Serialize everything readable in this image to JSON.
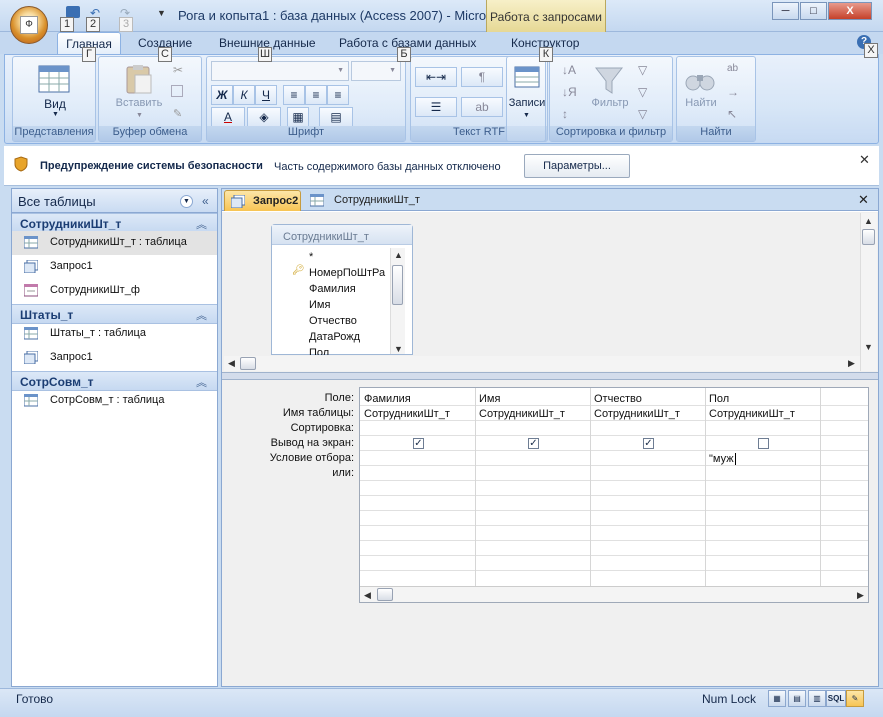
{
  "app": {
    "title": "Рога и копыта1 : база данных (Access 2007) - Micros...",
    "context_tab_title": "Работа с запросами",
    "office_button_keytip": "Ф",
    "qat_keytips": [
      "1",
      "2",
      "3"
    ]
  },
  "window_controls": {
    "minimize": "─",
    "maximize": "□",
    "close": "X",
    "help": "?"
  },
  "ribbon": {
    "tabs": [
      {
        "label": "Главная",
        "keytip": "Г"
      },
      {
        "label": "Создание",
        "keytip": "С"
      },
      {
        "label": "Внешние данные",
        "keytip": "Ш"
      },
      {
        "label": "Работа с базами данных",
        "keytip": "Б"
      },
      {
        "label": "Конструктор",
        "keytip": "К"
      }
    ],
    "groups": {
      "views": {
        "label": "Представления",
        "button": "Вид"
      },
      "clipboard": {
        "label": "Буфер обмена",
        "button": "Вставить"
      },
      "font": {
        "label": "Шрифт",
        "bold": "Ж",
        "italic": "К",
        "underline": "Ч",
        "font_color": "A"
      },
      "rich_text": {
        "label": "Текст RTF"
      },
      "records": {
        "button": "Записи"
      },
      "sort_filter": {
        "label": "Сортировка и фильтр",
        "button": "Фильтр"
      },
      "find": {
        "label": "Найти",
        "button": "Найти"
      }
    }
  },
  "security_bar": {
    "title": "Предупреждение системы безопасности",
    "message": "Часть содержимого базы данных отключено",
    "button": "Параметры...",
    "close": "✕"
  },
  "nav_pane": {
    "header": "Все таблицы",
    "groups": [
      {
        "name": "СотрудникиШт_т",
        "items": [
          {
            "label": "СотрудникиШт_т : таблица",
            "icon": "table-icon"
          },
          {
            "label": "Запрос1",
            "icon": "query-icon"
          },
          {
            "label": "СотрудникиШт_ф",
            "icon": "form-icon"
          }
        ]
      },
      {
        "name": "Штаты_т",
        "items": [
          {
            "label": "Штаты_т : таблица",
            "icon": "table-icon"
          },
          {
            "label": "Запрос1",
            "icon": "query-icon"
          }
        ]
      },
      {
        "name": "СотрСовм_т",
        "items": [
          {
            "label": "СотрСовм_т : таблица",
            "icon": "table-icon"
          }
        ]
      }
    ]
  },
  "doc_tabs": [
    {
      "label": "Запрос2",
      "active": true
    },
    {
      "label": "СотрудникиШт_т",
      "active": false
    }
  ],
  "table_box": {
    "title": "СотрудникиШт_т",
    "fields": [
      "*",
      "НомерПоШтРа",
      "Фамилия",
      "Имя",
      "Отчество",
      "ДатаРожд",
      "Пол"
    ]
  },
  "qbe": {
    "row_labels": [
      "Поле:",
      "Имя таблицы:",
      "Сортировка:",
      "Вывод на экран:",
      "Условие отбора:",
      "или:"
    ],
    "columns": [
      {
        "field": "Фамилия",
        "table": "СотрудникиШт_т",
        "show": true,
        "criteria": ""
      },
      {
        "field": "Имя",
        "table": "СотрудникиШт_т",
        "show": true,
        "criteria": ""
      },
      {
        "field": "Отчество",
        "table": "СотрудникиШт_т",
        "show": true,
        "criteria": ""
      },
      {
        "field": "Пол",
        "table": "СотрудникиШт_т",
        "show": false,
        "criteria": "\"муж"
      }
    ]
  },
  "status_bar": {
    "left": "Готово",
    "num_lock": "Num Lock",
    "view_buttons": [
      "datasheet-view-icon",
      "pivot-table-icon",
      "pivot-chart-icon",
      "SQL",
      "design-view-icon"
    ]
  },
  "colors": {
    "accent": "#f7c454",
    "ribbon": "#d7e6f7",
    "frame": "#c9dcf1"
  }
}
